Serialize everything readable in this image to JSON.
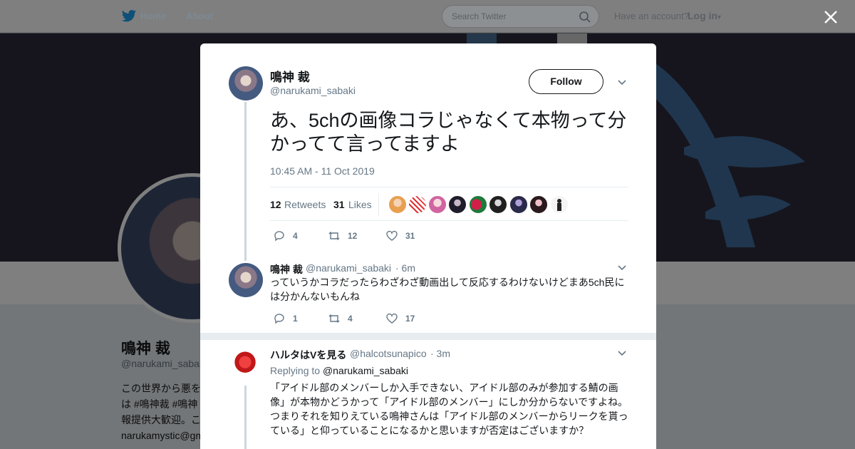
{
  "nav": {
    "home_label": "Home",
    "about_label": "About",
    "search_placeholder": "Search Twitter",
    "have_account": "Have an account?",
    "login_label": "Log in",
    "brand_color": "#1da1f2"
  },
  "profile_background": {
    "name": "鳴神 裁",
    "handle": "@narukami_sabaki",
    "bio_lines": [
      "この世界から悪を",
      "は #鳴神裁 #鳴神",
      "報提供大歓迎。こ",
      "narukamystic@gm"
    ]
  },
  "tweet": {
    "author_name": "鳴神 裁",
    "author_handle": "@narukami_sabaki",
    "follow_label": "Follow",
    "text": "あ、5chの画像コラじゃなくて本物って分かってて言ってますよ",
    "timestamp": "10:45 AM - 11 Oct 2019",
    "retweets_count": "12",
    "retweets_label": "Retweets",
    "likes_count": "31",
    "likes_label": "Likes",
    "actions": {
      "replies": "4",
      "retweets": "12",
      "likes": "31"
    }
  },
  "replies": [
    {
      "author_name": "鳴神 裁",
      "author_handle": "@narukami_sabaki",
      "time": "· 6m",
      "text": "っていうかコラだったらわざわざ動画出して反応するわけないけどまあ5ch民には分かんないもんね",
      "actions": {
        "replies": "1",
        "retweets": "4",
        "likes": "17"
      }
    },
    {
      "author_name": "ハルタはVを見る",
      "author_handle": "@halcotsunapico",
      "time": "· 3m",
      "replying_to_label": "Replying to",
      "replying_to_handle": "@narukami_sabaki",
      "text": "「アイドル部のメンバーしか入手できない、アイドル部のみが参加する鯖の画像」が本物かどうかって「アイドル部のメンバー」にしか分からないですよね。つまりそれを知りえている鳴神さんは「アイドル部のメンバーからリークを貰っている」と仰っていることになるかと思いますが否定はございますか？"
    }
  ]
}
